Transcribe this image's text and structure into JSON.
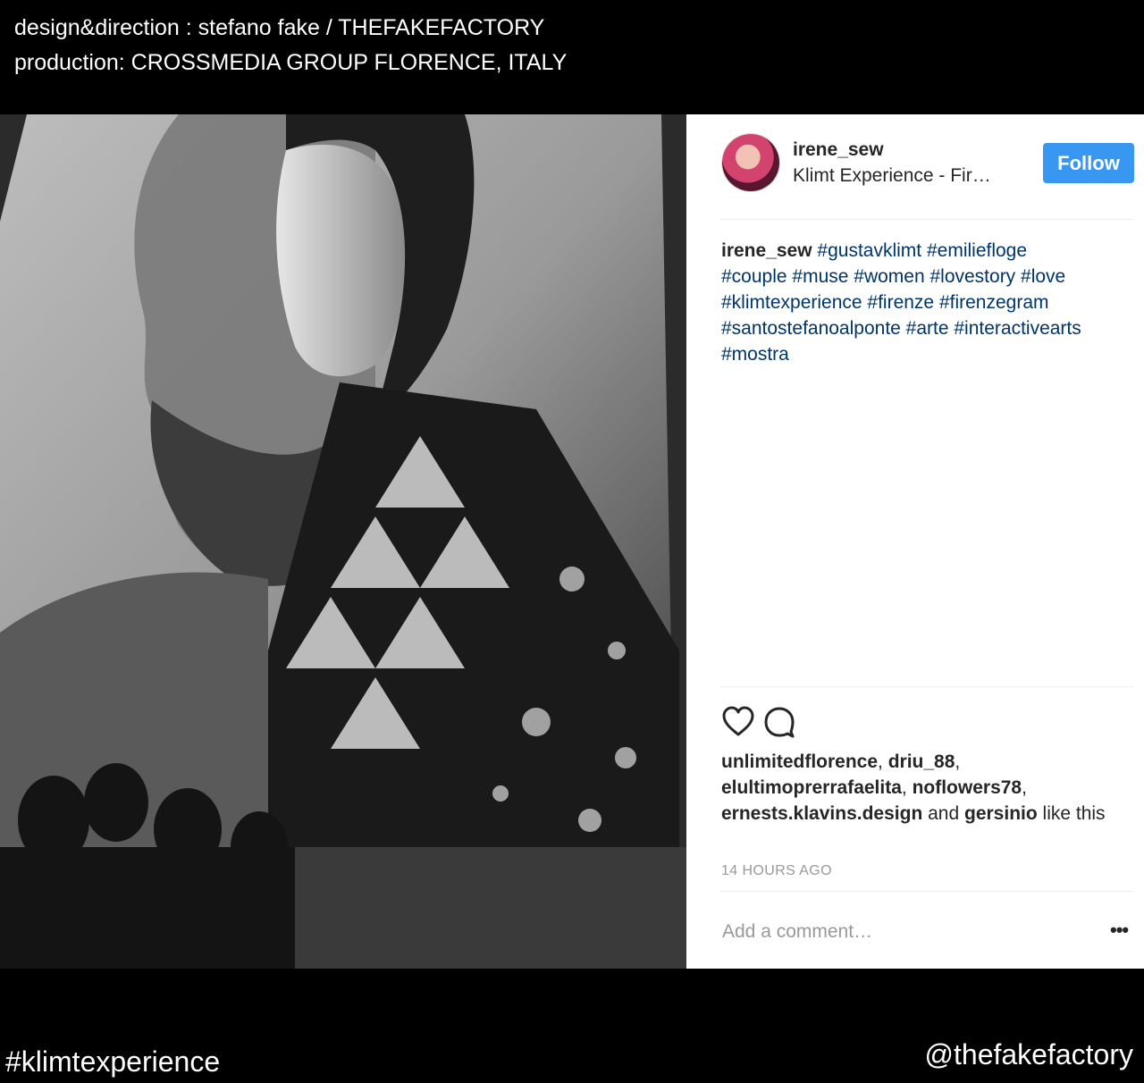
{
  "credits": {
    "line1": "design&direction : stefano fake / THEFAKEFACTORY",
    "line2": "production: CROSSMEDIA GROUP FLORENCE, ITALY"
  },
  "post": {
    "username": "irene_sew",
    "location": "Klimt Experience - Fir…",
    "follow_label": "Follow",
    "caption_user": "irene_sew",
    "hashtags_line1": "#gustavklimt #emiliefloge",
    "hashtags_line2": "#couple #muse #women #lovestory #love",
    "hashtags_line3": "#klimtexperience #firenze #firenzegram",
    "hashtags_line4": "#santostefanoalponte #arte #interactivearts",
    "hashtags_line5": "#mostra",
    "likes_user1": "unlimitedflorence",
    "likes_user2": "driu_88",
    "likes_user3": "elultimoprerrafaelita",
    "likes_user4": "noflowers78",
    "likes_user5": "ernests.klavins.design",
    "likes_user6": "gersinio",
    "likes_and": " and ",
    "likes_suffix": " like this",
    "time": "14 HOURS AGO",
    "comment_placeholder": "Add a comment…",
    "more_label": "•••"
  },
  "footer": {
    "hashtag": "#klimtexperience",
    "handle": "@thefakefactory"
  },
  "icons": {
    "heart": "heart-icon",
    "comment": "comment-icon"
  },
  "colors": {
    "follow_blue": "#3897f0",
    "hashtag_blue": "#003569"
  }
}
